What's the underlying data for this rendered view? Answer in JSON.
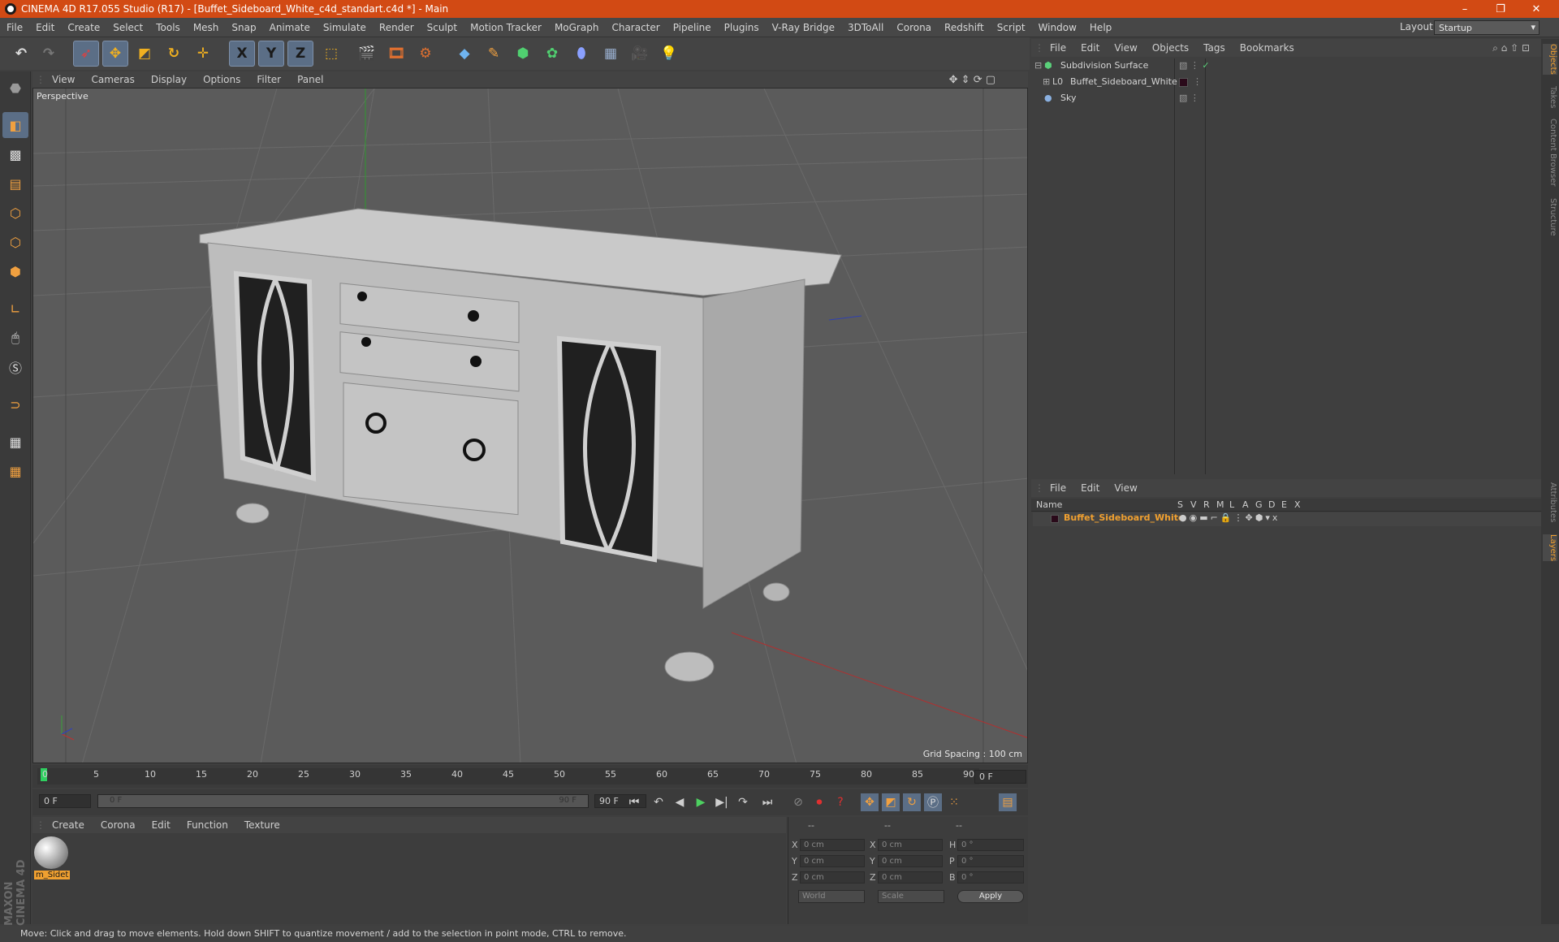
{
  "app": {
    "title": "CINEMA 4D R17.055 Studio (R17) - [Buffet_Sideboard_White_c4d_standart.c4d *] - Main",
    "window_controls": [
      "–",
      "❐",
      "✕"
    ]
  },
  "menubar": {
    "items": [
      "File",
      "Edit",
      "Create",
      "Select",
      "Tools",
      "Mesh",
      "Snap",
      "Animate",
      "Simulate",
      "Render",
      "Sculpt",
      "Motion Tracker",
      "MoGraph",
      "Character",
      "Pipeline",
      "Plugins",
      "V-Ray Bridge",
      "3DToAll",
      "Corona",
      "Redshift",
      "Script",
      "Window",
      "Help"
    ],
    "layout_label": "Layout:",
    "layout_value": "Startup"
  },
  "toolbar": {
    "icons": [
      "undo-icon",
      "redo-icon",
      "select-icon",
      "move-icon",
      "scale-icon",
      "rotate-icon",
      "transform-icon",
      "x-axis-icon",
      "y-axis-icon",
      "z-axis-icon",
      "coordinate-system-icon",
      "render-view-icon",
      "render-picture-viewer-icon",
      "edit-render-settings-icon",
      "cube-icon",
      "pen-icon",
      "subdivision-icon",
      "mograph-cloner-icon",
      "deformer-icon",
      "floor-icon",
      "camera-icon",
      "light-icon"
    ],
    "axis_labels": [
      "X",
      "Y",
      "Z"
    ]
  },
  "viewport": {
    "menu": [
      "View",
      "Cameras",
      "Display",
      "Options",
      "Filter",
      "Panel"
    ],
    "camera_label": "Perspective",
    "grid_spacing": "Grid Spacing : 100 cm"
  },
  "timeline": {
    "ticks": [
      "0",
      "5",
      "10",
      "15",
      "20",
      "25",
      "30",
      "35",
      "40",
      "45",
      "50",
      "55",
      "60",
      "65",
      "70",
      "75",
      "80",
      "85",
      "90"
    ],
    "end_field": "0 F",
    "current_frame": "0 F",
    "range_start": "0 F",
    "range_end": "90 F",
    "max_frame": "90 F"
  },
  "materials": {
    "menu": [
      "Create",
      "Corona",
      "Edit",
      "Function",
      "Texture"
    ],
    "items": [
      {
        "name": "m_Sidet"
      }
    ]
  },
  "coordinates": {
    "headers": [
      "--",
      "--",
      "--"
    ],
    "rows": [
      {
        "a": "X",
        "av": "0 cm",
        "b": "X",
        "bv": "0 cm",
        "c": "H",
        "cv": "0 °"
      },
      {
        "a": "Y",
        "av": "0 cm",
        "b": "Y",
        "bv": "0 cm",
        "c": "P",
        "cv": "0 °"
      },
      {
        "a": "Z",
        "av": "0 cm",
        "b": "Z",
        "bv": "0 cm",
        "c": "B",
        "cv": "0 °"
      }
    ],
    "mode": "World",
    "type": "Scale",
    "apply": "Apply"
  },
  "objects": {
    "menu": [
      "File",
      "Edit",
      "View",
      "Objects",
      "Tags",
      "Bookmarks"
    ],
    "items": [
      {
        "name": "Subdivision Surface",
        "color": "#b8e8a0"
      },
      {
        "name": "Buffet_Sideboard_White",
        "color": "#d6d6d6"
      },
      {
        "name": "Sky",
        "color": "#d6d6d6"
      }
    ]
  },
  "layers": {
    "menu": [
      "File",
      "Edit",
      "View"
    ],
    "columns": [
      "Name",
      "S",
      "V",
      "R",
      "M",
      "L",
      "A",
      "G",
      "D",
      "E",
      "X"
    ],
    "items": [
      {
        "name": "Buffet_Sideboard_White",
        "color": "#f0a030"
      }
    ]
  },
  "right_tabs": [
    "Objects",
    "Takes",
    "Content Browser",
    "Structure",
    "Attributes",
    "Layers"
  ],
  "status": "Move: Click and drag to move elements. Hold down SHIFT to quantize movement / add to the selection in point mode, CTRL to remove.",
  "brand": "MAXON CINEMA 4D"
}
